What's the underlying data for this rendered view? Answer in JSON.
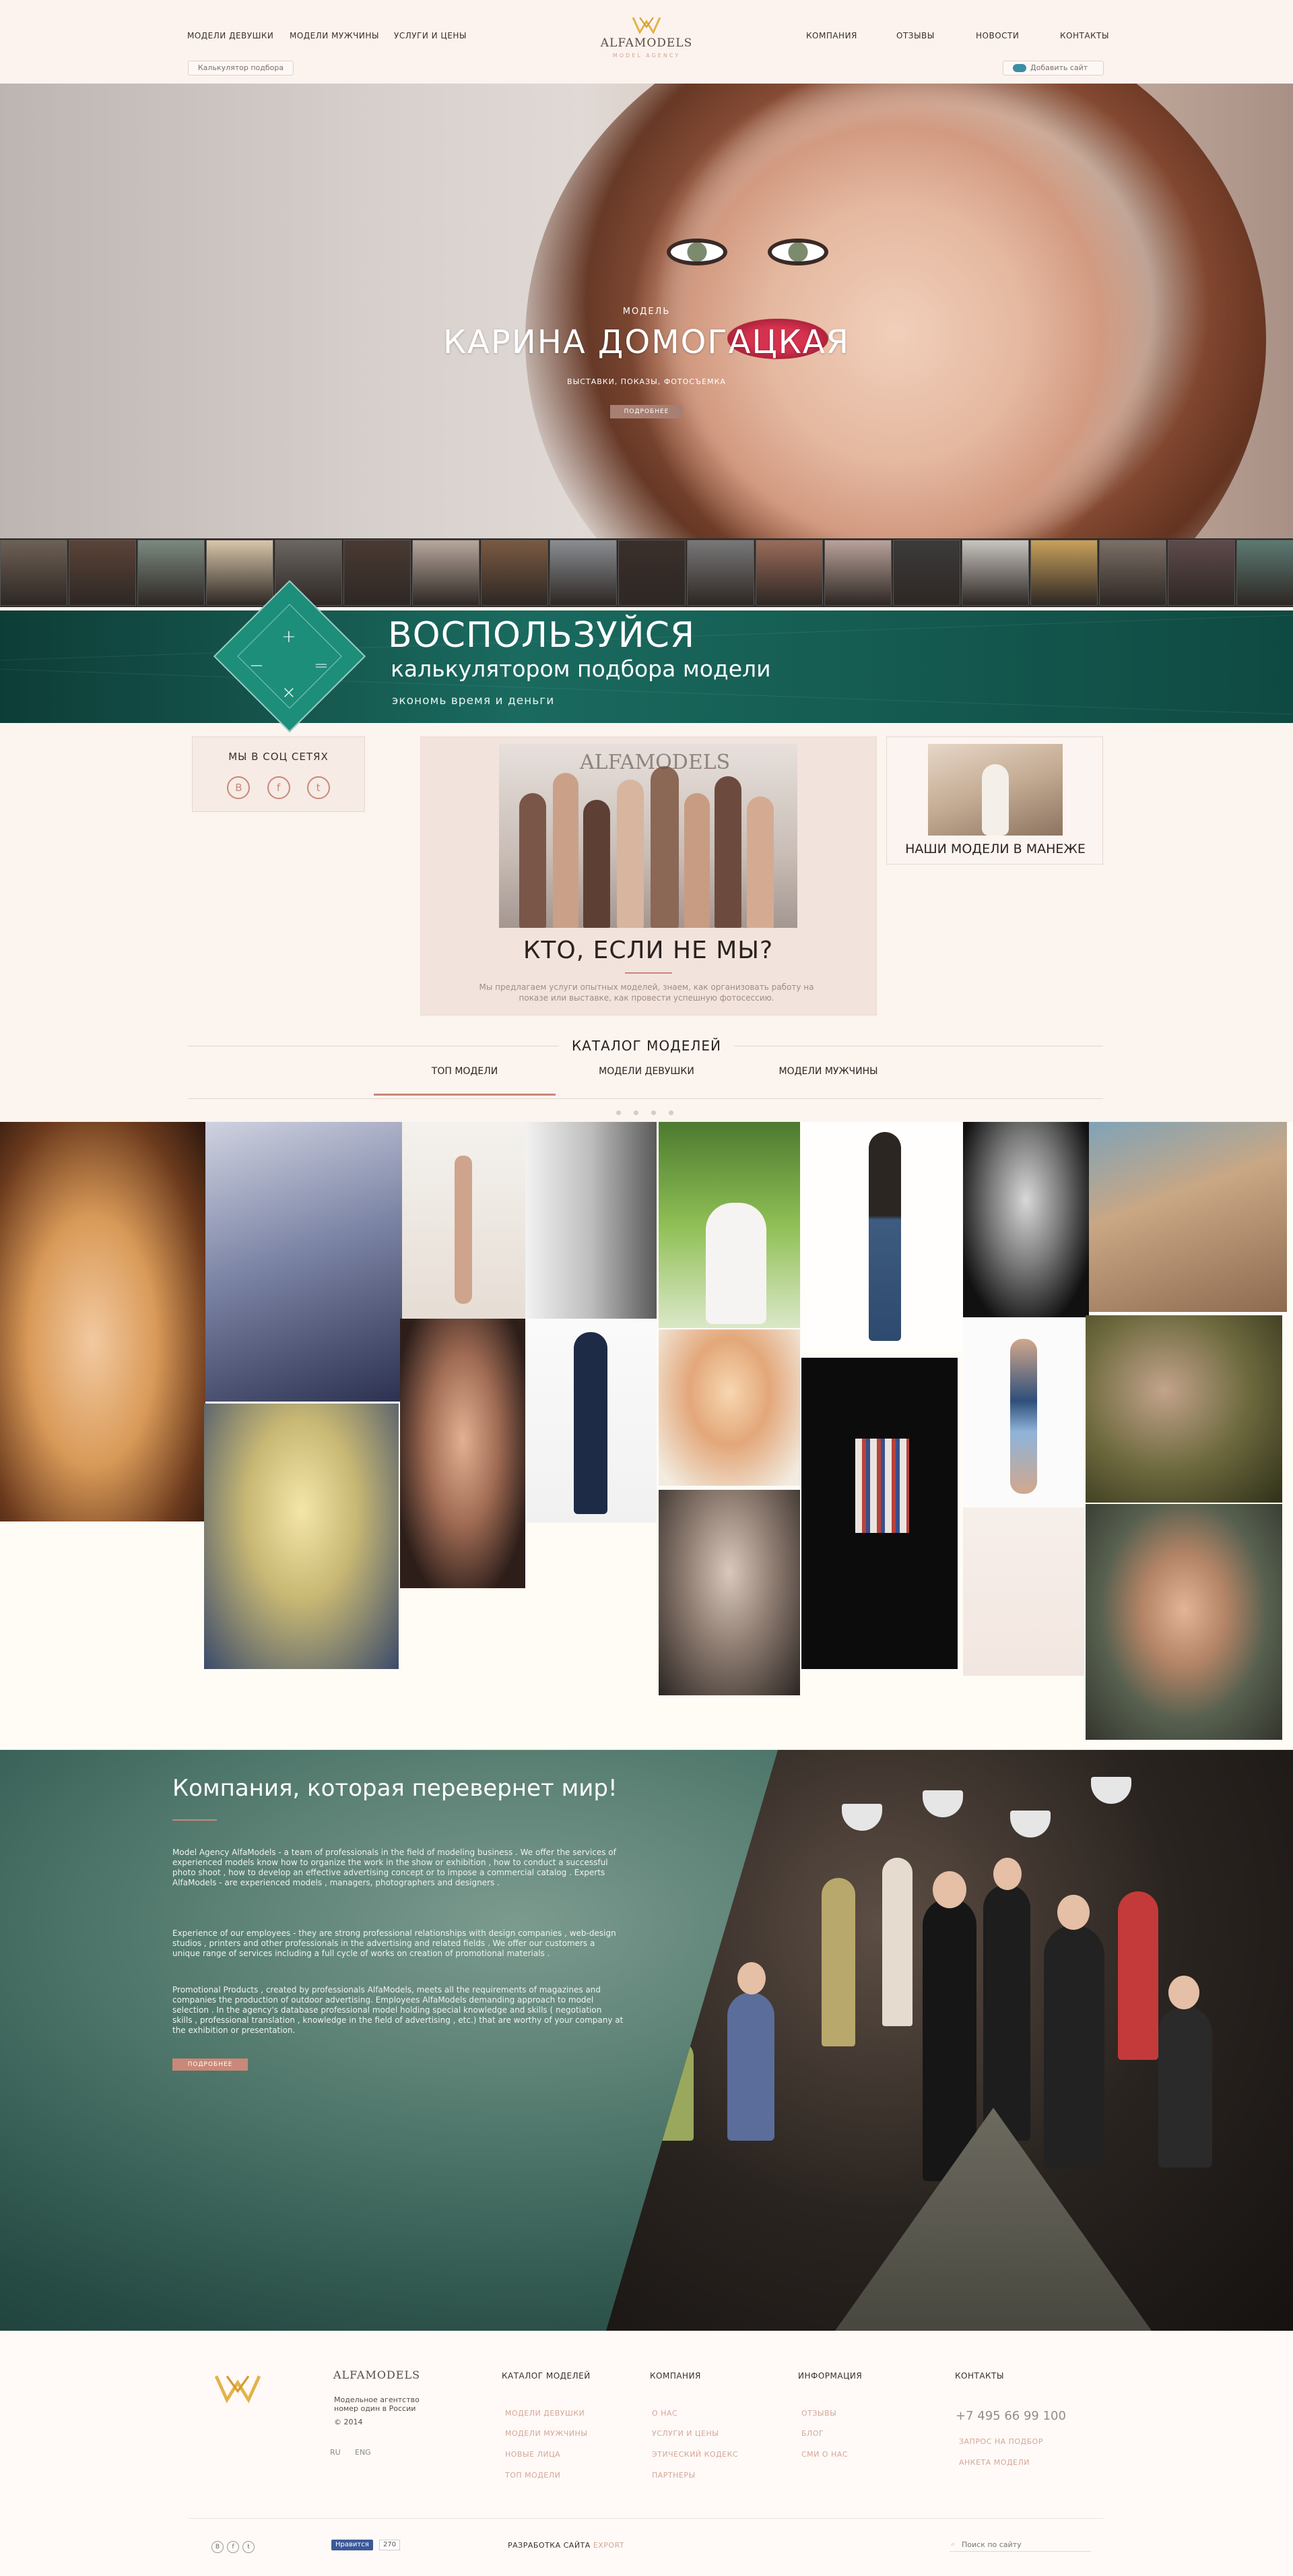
{
  "header": {
    "nav_left": [
      "МОДЕЛИ ДЕВУШКИ",
      "МОДЕЛИ МУЖЧИНЫ",
      "УСЛУГИ И ЦЕНЫ"
    ],
    "nav_right": [
      "КОМПАНИЯ",
      "ОТЗЫВЫ",
      "НОВОСТИ",
      "КОНТАКТЫ"
    ],
    "calculator_button": "Калькулятор подбора",
    "add_site_button": "Добавить сайт",
    "logo_name": "ALFAMODELS",
    "logo_tagline": "MODEL AGENCY"
  },
  "hero": {
    "kicker": "МОДЕЛЬ",
    "title": "КАРИНА ДОМОГАЦКАЯ",
    "subtitle": "ВЫСТАВКИ, ПОКАЗЫ, ФОТОСЪЕМКА",
    "button": "ПОДРОБНЕЕ"
  },
  "thumbnails": {
    "colors": [
      "#6d6055",
      "#5a4438",
      "#7b8a80",
      "#d8c6aa",
      "#6b6661",
      "#4a3a33",
      "#b8a79c",
      "#7a5a42",
      "#8a8d92",
      "#3a2f2b",
      "#787878",
      "#9a6c5a",
      "#b9a29a",
      "#3b3b3b",
      "#c8c4c0",
      "#c8a15b",
      "#7b6f66",
      "#5e4a4a",
      "#5c7a72",
      "#d2c9c0"
    ]
  },
  "promo": {
    "title": "ВОСПОЛЬЗУЙСЯ",
    "subtitle": "калькулятором подбора модели",
    "note": "экономь время и деньги"
  },
  "social": {
    "title": "МЫ В СОЦ СЕТЯХ",
    "icons": [
      "В",
      "f",
      "t"
    ]
  },
  "about": {
    "title": "КТО, ЕСЛИ НЕ МЫ?",
    "text": "Мы предлагаем услуги опытных моделей, знаем, как организовать работу на показе или выставке, как провести успешную фотосессию."
  },
  "manege": {
    "title": "НАШИ МОДЕЛИ В МАНЕЖЕ"
  },
  "catalog": {
    "title": "КАТАЛОГ МОДЕЛЕЙ",
    "tabs": [
      "ТОП МОДЕЛИ",
      "МОДЕЛИ ДЕВУШКИ",
      "МОДЕЛИ МУЖЧИНЫ"
    ],
    "active_tab": "ТОП МОДЕЛИ"
  },
  "company": {
    "title": "Компания, которая перевернет мир!",
    "paragraphs": [
      "Model Agency AlfaModels - a team of professionals in the field of modeling business . We offer the services of experienced models know how to organize the work in the show or exhibition , how to conduct a successful photo shoot , how to develop an effective advertising concept or to impose a commercial catalog . Experts AlfaModels - are experienced models , managers, photographers and designers .",
      "Experience of our employees - they are strong professional relationships with design companies , web-design studios , printers and other professionals in the advertising and related fields . We offer our customers a unique range of services including a full cycle of works on creation of promotional materials .",
      "Promotional Products , created by professionals AlfaModels, meets all the requirements of magazines and companies the production of outdoor advertising. Employees AlfaModels demanding approach to model selection . In the agency's database professional model holding special knowledge and skills ( negotiation skills , professional translation , knowledge in the field of advertising , etc.) that are worthy of your company at the exhibition or presentation."
    ],
    "button": "ПОДРОБНЕЕ"
  },
  "footer": {
    "logo_name": "ALFAMODELS",
    "about_line1": "Модельное агентство",
    "about_line2": "номер один в России",
    "copyright": "© 2014",
    "languages": [
      "RU",
      "ENG"
    ],
    "columns": [
      {
        "title": "КАТАЛОГ МОДЕЛЕЙ",
        "links": [
          "МОДЕЛИ ДЕВУШКИ",
          "МОДЕЛИ МУЖЧИНЫ",
          "НОВЫЕ ЛИЦА",
          "ТОП МОДЕЛИ"
        ]
      },
      {
        "title": "КОМПАНИЯ",
        "links": [
          "О НАС",
          "УСЛУГИ И ЦЕНЫ",
          "ЭТИЧЕСКИЙ КОДЕКС",
          "ПАРТНЕРЫ"
        ]
      },
      {
        "title": "ИНФОРМАЦИЯ",
        "links": [
          "ОТЗЫВЫ",
          "БЛОГ",
          "СМИ О НАС"
        ]
      }
    ],
    "contacts_title": "КОНТАКТЫ",
    "phone": "+7 495 66 99 100",
    "contact_links": [
      "ЗАПРОС НА ПОДБОР",
      "АНКЕТА МОДЕЛИ"
    ],
    "like_label": "Нравится",
    "like_count": "270",
    "dev_label": "РАЗРАБОТКА САЙТА",
    "dev_name": "EXPORT",
    "search_placeholder": "Поиск по сайту"
  },
  "colors": {
    "accent": "#c98878",
    "teal": "#1a6a5f",
    "background": "#fbf4ef"
  }
}
